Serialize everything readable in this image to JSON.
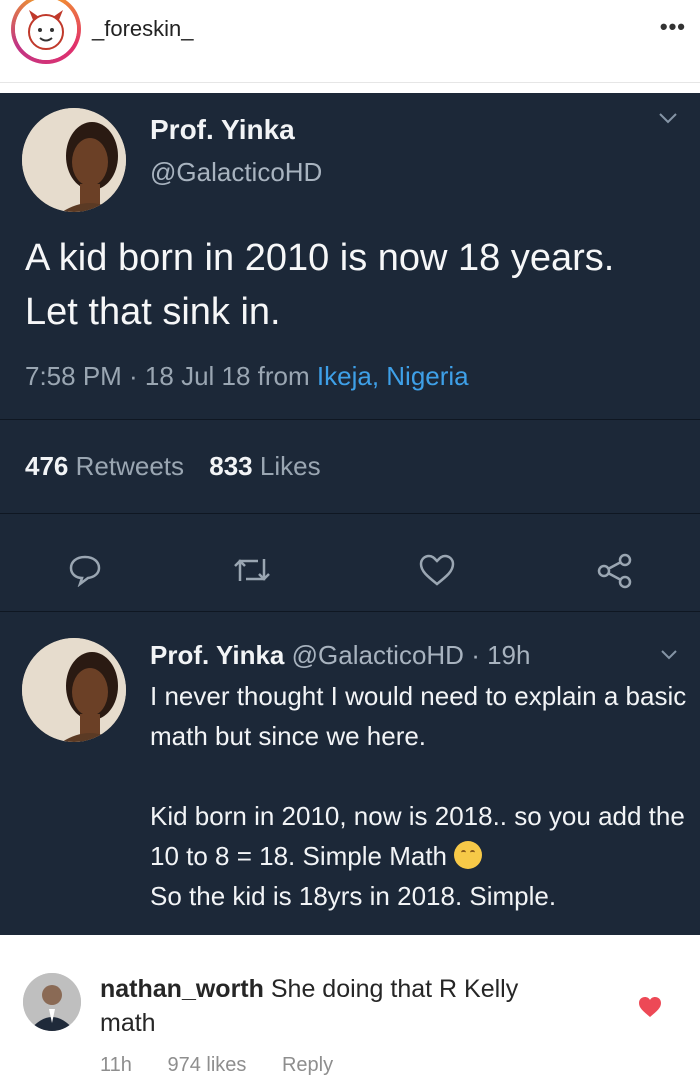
{
  "post": {
    "username": "_foreskin_",
    "more": "•••"
  },
  "tweet": {
    "name": "Prof. Yinka",
    "handle": "@GalacticoHD",
    "text": "A kid born in 2010 is now 18 years. Let that sink in.",
    "time": "7:58 PM · 18 Jul 18 from ",
    "location": "Ikeja, Nigeria",
    "retweets_count": "476",
    "retweets_label": "Retweets",
    "likes_count": "833",
    "likes_label": "Likes"
  },
  "reply": {
    "name": "Prof. Yinka",
    "handle": "@GalacticoHD",
    "time": "· 19h",
    "line1": "I never thought I would need to explain a basic math but since we here.",
    "line2": "Kid born in 2010, now is 2018.. so you add the 10 to 8 = 18. Simple Math",
    "line3": "So the kid is 18yrs in 2018. Simple."
  },
  "comment": {
    "username": "nathan_worth",
    "text": "She doing that R Kelly math",
    "age": "11h",
    "likes": "974 likes",
    "reply_label": "Reply"
  },
  "colors": {
    "panel": "#1c2838",
    "link": "#3ea0e8",
    "heart": "#ed4956"
  }
}
